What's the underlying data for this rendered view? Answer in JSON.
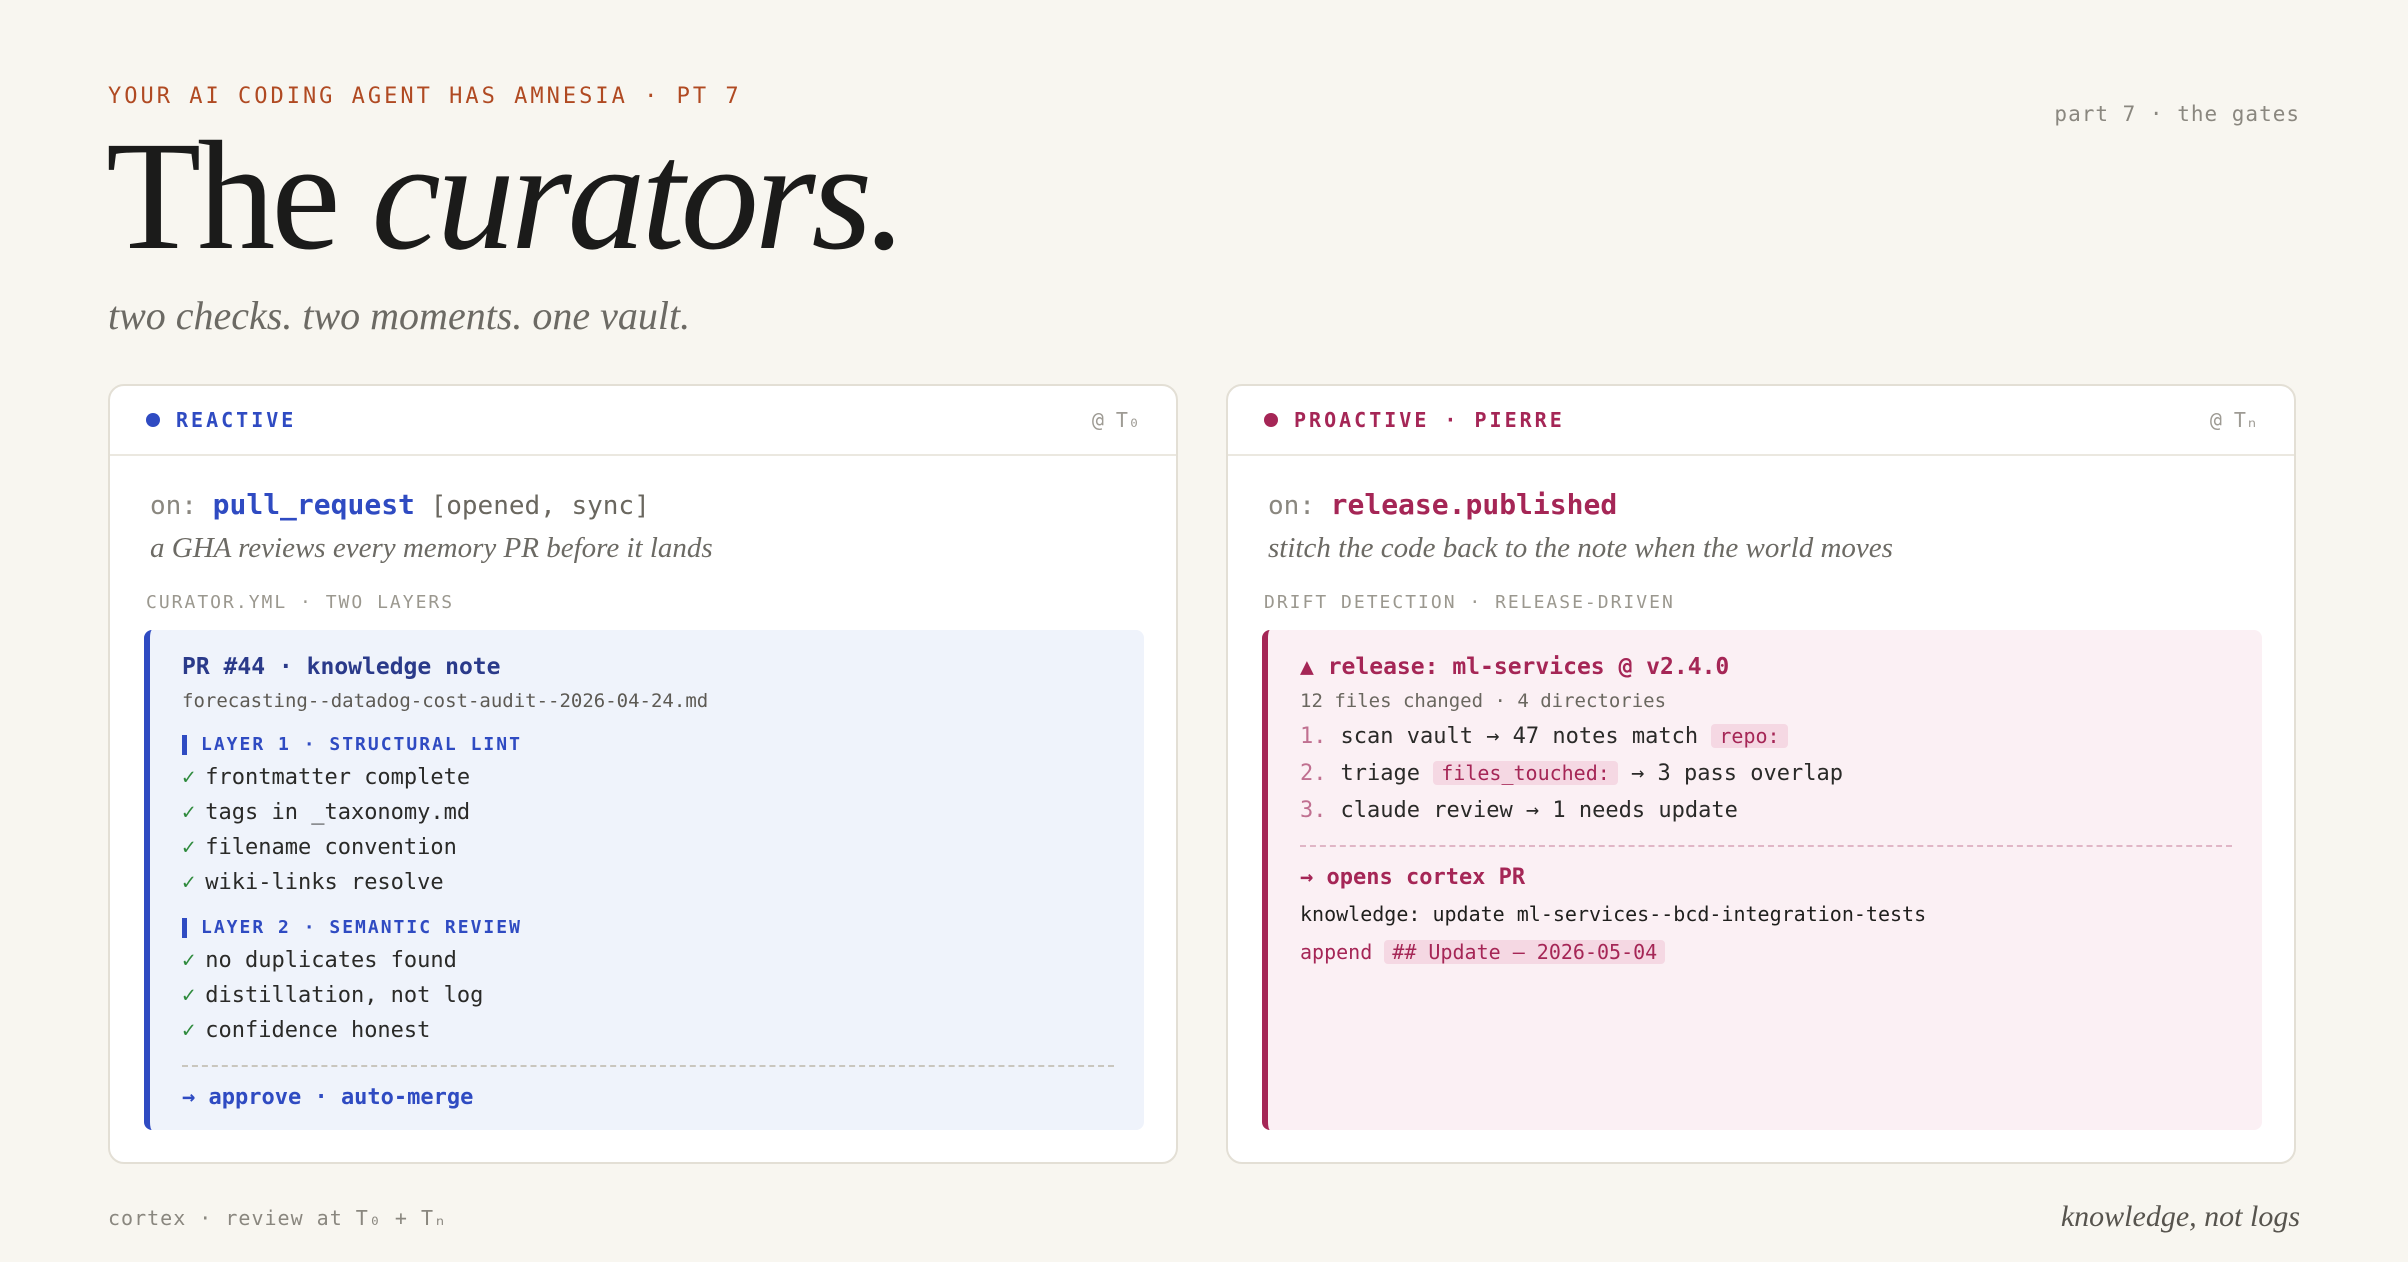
{
  "header": {
    "kicker": "YOUR AI CODING AGENT HAS AMNESIA · PT 7",
    "part_label": "part 7 · the gates",
    "title_plain": "The",
    "title_italic": "curators.",
    "subtitle": "two checks. two moments. one vault."
  },
  "colors": {
    "background": "#f8f6f0",
    "kicker": "#b04a22",
    "reactive_accent": "#2f4bc2",
    "proactive_accent": "#a52656",
    "check_green": "#2e8a3c"
  },
  "reactive": {
    "tag": "REACTIVE",
    "timepoint": "@ T₀",
    "on_label": "on:",
    "event": "pull_request",
    "event_types": "[opened, sync]",
    "tagline": "a GHA reviews every memory PR before it lands",
    "section_label": "CURATOR.YML · TWO LAYERS",
    "pr_title": "PR #44 · knowledge note",
    "pr_file": "forecasting--datadog-cost-audit--2026-04-24.md",
    "layer1_label": "LAYER 1 · STRUCTURAL LINT",
    "layer1_checks": [
      "frontmatter complete",
      "tags in _taxonomy.md",
      "filename convention",
      "wiki-links resolve"
    ],
    "layer2_label": "LAYER 2 · SEMANTIC REVIEW",
    "layer2_checks": [
      "no duplicates found",
      "distillation, not log",
      "confidence honest"
    ],
    "tick": "✓",
    "outcome": "→ approve · auto-merge"
  },
  "proactive": {
    "tag": "PROACTIVE · PIERRE",
    "timepoint": "@ Tₙ",
    "on_label": "on:",
    "event": "release.published",
    "tagline": "stitch the code back to the note when the world moves",
    "section_label": "DRIFT DETECTION · RELEASE-DRIVEN",
    "release_title": "▲ release: ml-services @ v2.4.0",
    "release_sub": "12 files changed · 4 directories",
    "steps": [
      {
        "num": "1.",
        "pre": "scan vault → 47 notes match",
        "chip": "repo:",
        "post": ""
      },
      {
        "num": "2.",
        "pre": "triage",
        "chip": "files_touched:",
        "post": "→ 3 pass overlap"
      },
      {
        "num": "3.",
        "pre": "claude review → 1 needs update",
        "chip": "",
        "post": ""
      }
    ],
    "opens": "→ opens cortex PR",
    "commit_msg": "knowledge: update ml-services--bcd-integration-tests",
    "append_label": "append",
    "append_chip": "## Update — 2026-05-04"
  },
  "footer": {
    "left": "cortex · review at T₀ + Tₙ",
    "right": "knowledge, not logs"
  }
}
